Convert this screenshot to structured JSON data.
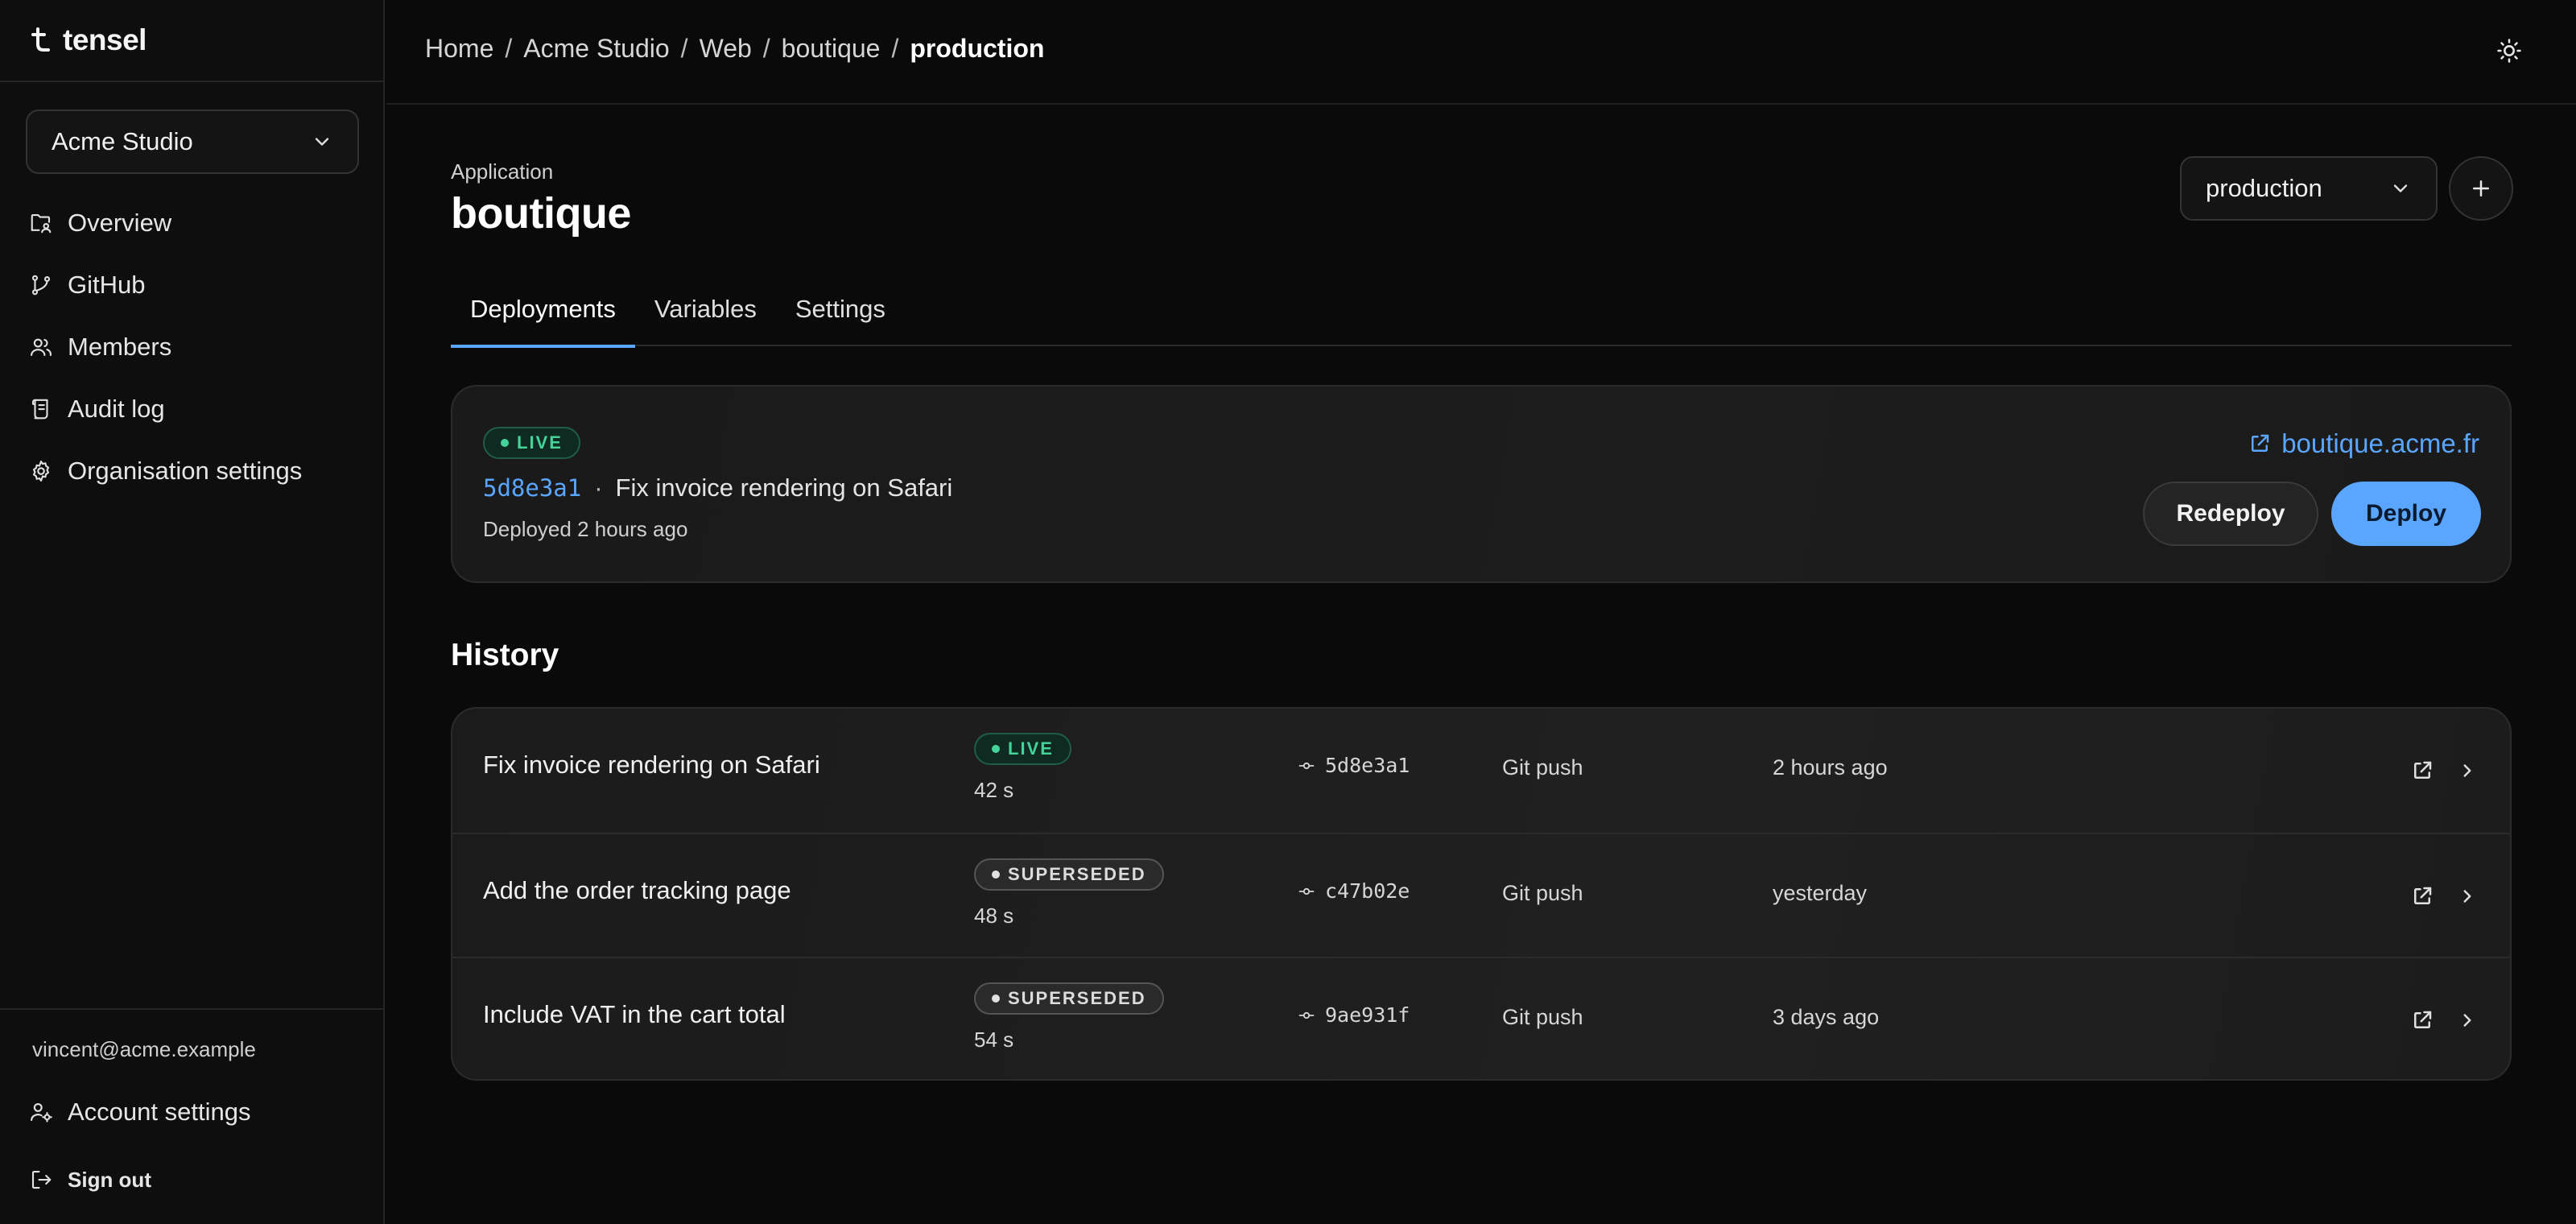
{
  "brand": {
    "name": "tensel"
  },
  "sidebar": {
    "org_selector": {
      "value": "Acme Studio"
    },
    "items": [
      {
        "label": "Overview",
        "icon": "folder-user-icon"
      },
      {
        "label": "GitHub",
        "icon": "git-branch-icon"
      },
      {
        "label": "Members",
        "icon": "users-icon"
      },
      {
        "label": "Audit log",
        "icon": "scroll-icon"
      },
      {
        "label": "Organisation settings",
        "icon": "gear-icon"
      }
    ],
    "footer": {
      "user_email": "vincent@acme.example",
      "account_settings": "Account settings",
      "sign_out": "Sign out"
    }
  },
  "header": {
    "breadcrumb": [
      "Home",
      "Acme Studio",
      "Web",
      "boutique",
      "production"
    ],
    "separator": "/"
  },
  "app": {
    "eyebrow": "Application",
    "name": "boutique",
    "environment_selector": {
      "value": "production"
    }
  },
  "tabs": [
    {
      "label": "Deployments",
      "active": true
    },
    {
      "label": "Variables",
      "active": false
    },
    {
      "label": "Settings",
      "active": false
    }
  ],
  "current_deployment": {
    "status": "LIVE",
    "commit": "5d8e3a1",
    "separator": "·",
    "message": "Fix invoice rendering on Safari",
    "deployed_ago": "Deployed 2 hours ago",
    "domain": "boutique.acme.fr",
    "redeploy_label": "Redeploy",
    "deploy_label": "Deploy"
  },
  "history": {
    "title": "History",
    "rows": [
      {
        "title": "Fix invoice rendering on Safari",
        "status": "LIVE",
        "duration": "42 s",
        "commit": "5d8e3a1",
        "source": "Git push",
        "time": "2 hours ago"
      },
      {
        "title": "Add the order tracking page",
        "status": "SUPERSEDED",
        "duration": "48 s",
        "commit": "c47b02e",
        "source": "Git push",
        "time": "yesterday"
      },
      {
        "title": "Include VAT in the cart total",
        "status": "SUPERSEDED",
        "duration": "54 s",
        "commit": "9ae931f",
        "source": "Git push",
        "time": "3 days ago"
      }
    ]
  },
  "colors": {
    "accent": "#5aa6ff",
    "live": "#45d39a",
    "background": "#0a0a0a"
  }
}
